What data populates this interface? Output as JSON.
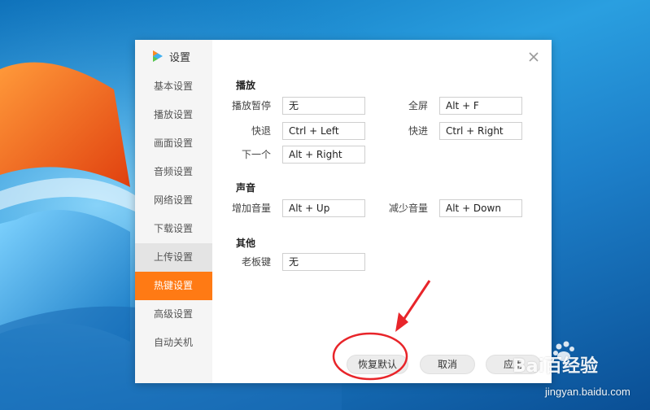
{
  "dialog": {
    "title": "设置",
    "close_icon": "close-icon",
    "sidebar": {
      "items": [
        {
          "label": "基本设置"
        },
        {
          "label": "播放设置"
        },
        {
          "label": "画面设置"
        },
        {
          "label": "音频设置"
        },
        {
          "label": "网络设置"
        },
        {
          "label": "下载设置"
        },
        {
          "label": "上传设置"
        },
        {
          "label": "热键设置"
        },
        {
          "label": "高级设置"
        },
        {
          "label": "自动关机"
        }
      ],
      "active_index": 7,
      "hover_index": 6
    },
    "sections": {
      "playback": {
        "title": "播放",
        "play_pause": {
          "label": "播放暂停",
          "value": "无"
        },
        "fullscreen": {
          "label": "全屏",
          "value": "Alt + F"
        },
        "rewind": {
          "label": "快退",
          "value": "Ctrl + Left"
        },
        "forward": {
          "label": "快进",
          "value": "Ctrl + Right"
        },
        "next": {
          "label": "下一个",
          "value": "Alt + Right"
        }
      },
      "sound": {
        "title": "声音",
        "volume_up": {
          "label": "增加音量",
          "value": "Alt + Up"
        },
        "volume_down": {
          "label": "减少音量",
          "value": "Alt + Down"
        }
      },
      "other": {
        "title": "其他",
        "boss_key": {
          "label": "老板键",
          "value": "无"
        }
      }
    },
    "footer": {
      "restore_label": "恢复默认",
      "cancel_label": "取消",
      "apply_label": "应用"
    }
  },
  "watermark": {
    "brand": "Bai百经验",
    "url": "jingyan.baidu.com"
  },
  "colors": {
    "accent": "#ff7a14",
    "annotation": "#e8252a"
  }
}
